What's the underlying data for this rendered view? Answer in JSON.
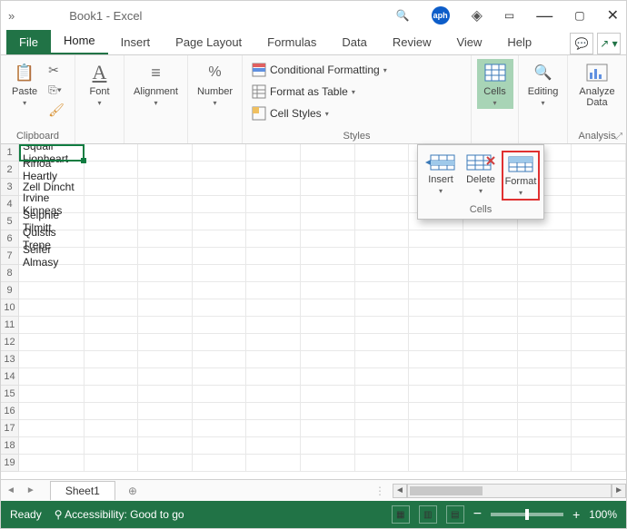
{
  "title": "Book1  -  Excel",
  "tabs": {
    "file": "File",
    "items": [
      "Home",
      "Insert",
      "Page Layout",
      "Formulas",
      "Data",
      "Review",
      "View",
      "Help"
    ],
    "active": 0
  },
  "ribbon": {
    "clipboard": {
      "label": "Clipboard",
      "paste": "Paste"
    },
    "font": {
      "label": "Font",
      "btn": "Font"
    },
    "alignment": {
      "label": "",
      "btn": "Alignment"
    },
    "number": {
      "label": "",
      "btn": "Number"
    },
    "styles": {
      "label": "Styles",
      "cond": "Conditional Formatting",
      "table": "Format as Table",
      "cell": "Cell Styles"
    },
    "cells": {
      "label": "",
      "btn": "Cells"
    },
    "editing": {
      "label": "",
      "btn": "Editing"
    },
    "analysis": {
      "label": "Analysis",
      "btn": "Analyze Data"
    }
  },
  "cells_panel": {
    "insert": "Insert",
    "delete": "Delete",
    "format": "Format",
    "group": "Cells"
  },
  "column_a": [
    "Squall Lionheart",
    "Rinoa Heartly",
    "Zell Dincht",
    "Irvine Kinneas",
    "Selphie Tilmitt",
    "Quistis Trepe",
    "Seifer Almasy"
  ],
  "row_count": 19,
  "sheet": {
    "name": "Sheet1"
  },
  "status": {
    "ready": "Ready",
    "access": "Accessibility: Good to go",
    "zoom": "100%"
  }
}
